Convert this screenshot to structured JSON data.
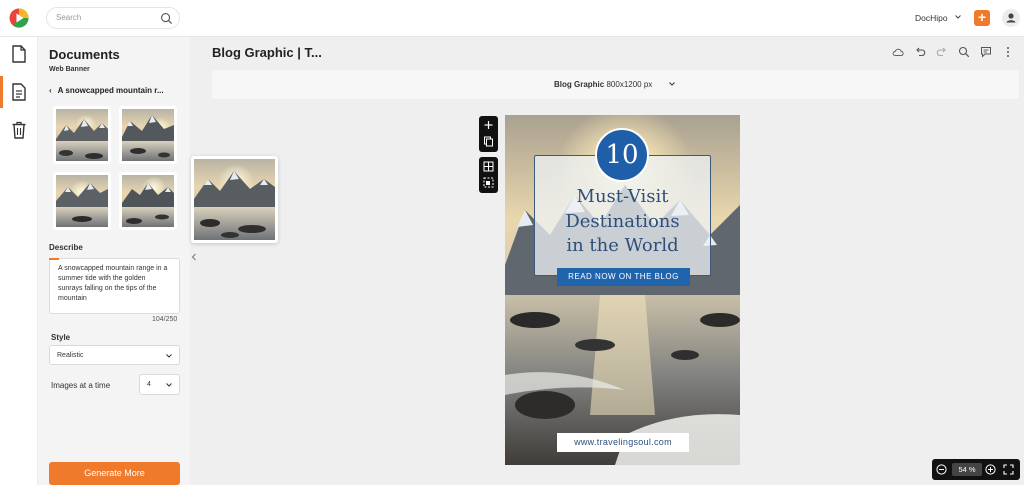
{
  "topbar": {
    "search_placeholder": "Search",
    "brand": "DocHipo",
    "add_label": "+"
  },
  "panel": {
    "title": "Documents",
    "subtitle": "Web Banner",
    "prompt_title": "A snowcapped mountain r...",
    "describe_label": "Describe",
    "description": "A snowcapped mountain range in a summer tide with the golden sunrays falling on the tips of the mountain",
    "char_counter": "104/250",
    "style_label": "Style",
    "style_value": "Realistic",
    "images_label": "Images at a time",
    "images_value": "4",
    "generate_button": "Generate More"
  },
  "document": {
    "title": "Blog Graphic | T...",
    "size_name": "Blog Graphic",
    "size_dims": "800x1200 px"
  },
  "artboard": {
    "number": "10",
    "headline_1": "Must-Visit",
    "headline_2": "Destinations",
    "headline_3": "in the World",
    "cta": "READ NOW ON THE BLOG",
    "url": "www.travelingsoul.com"
  },
  "zoom": {
    "value": "54 %"
  },
  "colors": {
    "accent": "#f07a2b",
    "headline": "#2d4f7c",
    "badge": "#1f5ea8",
    "cta": "#2064ae"
  }
}
